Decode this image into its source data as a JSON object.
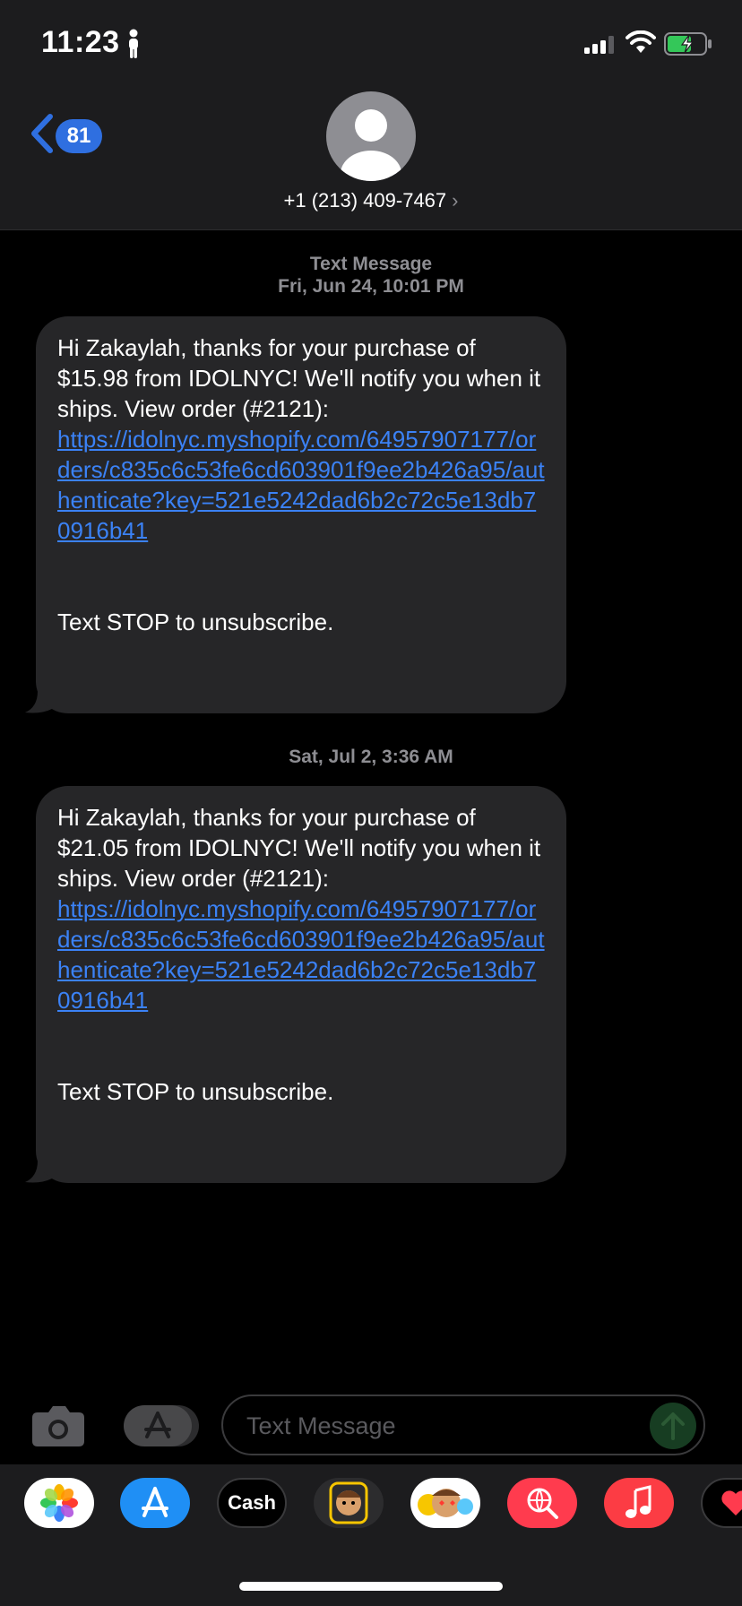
{
  "status_bar": {
    "time": "11:23"
  },
  "header": {
    "back_count": "81",
    "contact": "+1 (213) 409-7467",
    "chevron": "›"
  },
  "conversation": {
    "messages": [
      {
        "timestamp_service": "Text Message",
        "timestamp": "Fri, Jun 24, 10:01 PM",
        "text": "Hi Zakaylah, thanks for your purchase of $15.98 from IDOLNYC! We'll notify you when it ships. View order (#2121):",
        "link": "https://idolnyc.myshopify.com/64957907177/orders/c835c6c53fe6cd603901f9ee2b426a95/authenticate?key=521e5242dad6b2c72c5e13db70916b41",
        "footer": "Text STOP to unsubscribe."
      },
      {
        "timestamp": "Sat, Jul 2, 3:36 AM",
        "text": "Hi Zakaylah, thanks for your purchase of $21.05 from IDOLNYC! We'll notify you when it ships. View order (#2121):",
        "link": "https://idolnyc.myshopify.com/64957907177/orders/c835c6c53fe6cd603901f9ee2b426a95/authenticate?key=521e5242dad6b2c72c5e13db70916b41",
        "footer": "Text STOP to unsubscribe."
      }
    ]
  },
  "input": {
    "placeholder": "Text Message"
  },
  "app_drawer": {
    "apps": [
      {
        "name": "photos-app-icon"
      },
      {
        "name": "app-store-icon"
      },
      {
        "name": "apple-cash-icon",
        "label": "Cash"
      },
      {
        "name": "memoji-stickers-icon"
      },
      {
        "name": "animoji-icon"
      },
      {
        "name": "image-search-icon"
      },
      {
        "name": "music-icon"
      },
      {
        "name": "digital-touch-icon"
      }
    ]
  },
  "colors": {
    "accent": "#2f6fe0",
    "link": "#3b82f6",
    "bubble": "#262628",
    "header_bg": "#1c1c1e"
  }
}
